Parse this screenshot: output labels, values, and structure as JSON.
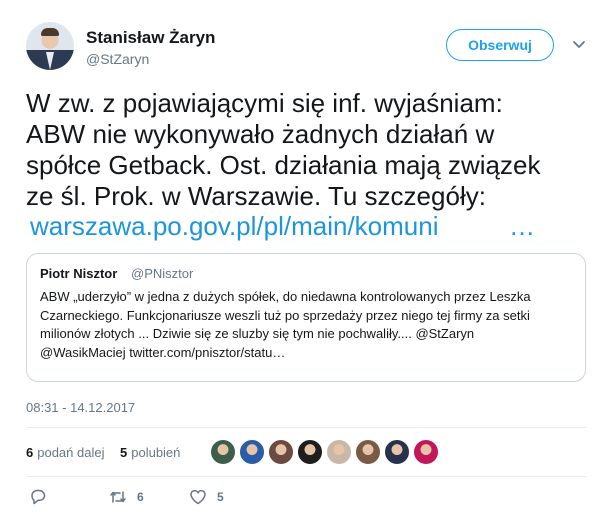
{
  "author": {
    "name": "Stanisław Żaryn",
    "handle": "@StZaryn",
    "follow_label": "Obserwuj"
  },
  "tweet": {
    "lines": [
      "W zw. z pojawiającymi się inf. wyjaśniam:",
      "ABW nie wykonywało żadnych działań w",
      "spółce Getback. Ost. działania mają związek",
      "ze śl. Prok. w Warszawie. Tu szczegóły:"
    ],
    "link": "warszawa.po.gov.pl/pl/main/komuni",
    "link_ellipsis": "…"
  },
  "quote": {
    "name": "Piotr Nisztor",
    "handle": "@PNisztor",
    "lines": [
      "ABW „uderzyło” w jedna z dużych spółek, do niedawna kontrolowanych przez Leszka",
      "Czarneckiego. Funkcjonariusze weszli tuż po sprzedaży przez niego tej firmy za setki",
      "milionów złotych ... Dziwie się ze sluzby się tym nie pochwaliły.... @StZaryn",
      "@WasikMaciej twitter.com/pnisztor/statu…"
    ]
  },
  "timestamp": "08:31 - 14.12.2017",
  "stats": {
    "retweets_count": "6",
    "retweets_label": "podań dalej",
    "likes_count": "5",
    "likes_label": "polubień",
    "liker_colors": [
      "#3b5f4a",
      "#2a5ca8",
      "#6b4a3f",
      "#1e1e1e",
      "#c9b8a8",
      "#7a5a44",
      "#28324f",
      "#c2185b"
    ]
  },
  "actions": {
    "reply_count": "",
    "retweet_count": "6",
    "like_count": "5"
  },
  "colors": {
    "accent": "#1da1f2",
    "link": "#1b95e0",
    "secondary": "#657786"
  }
}
